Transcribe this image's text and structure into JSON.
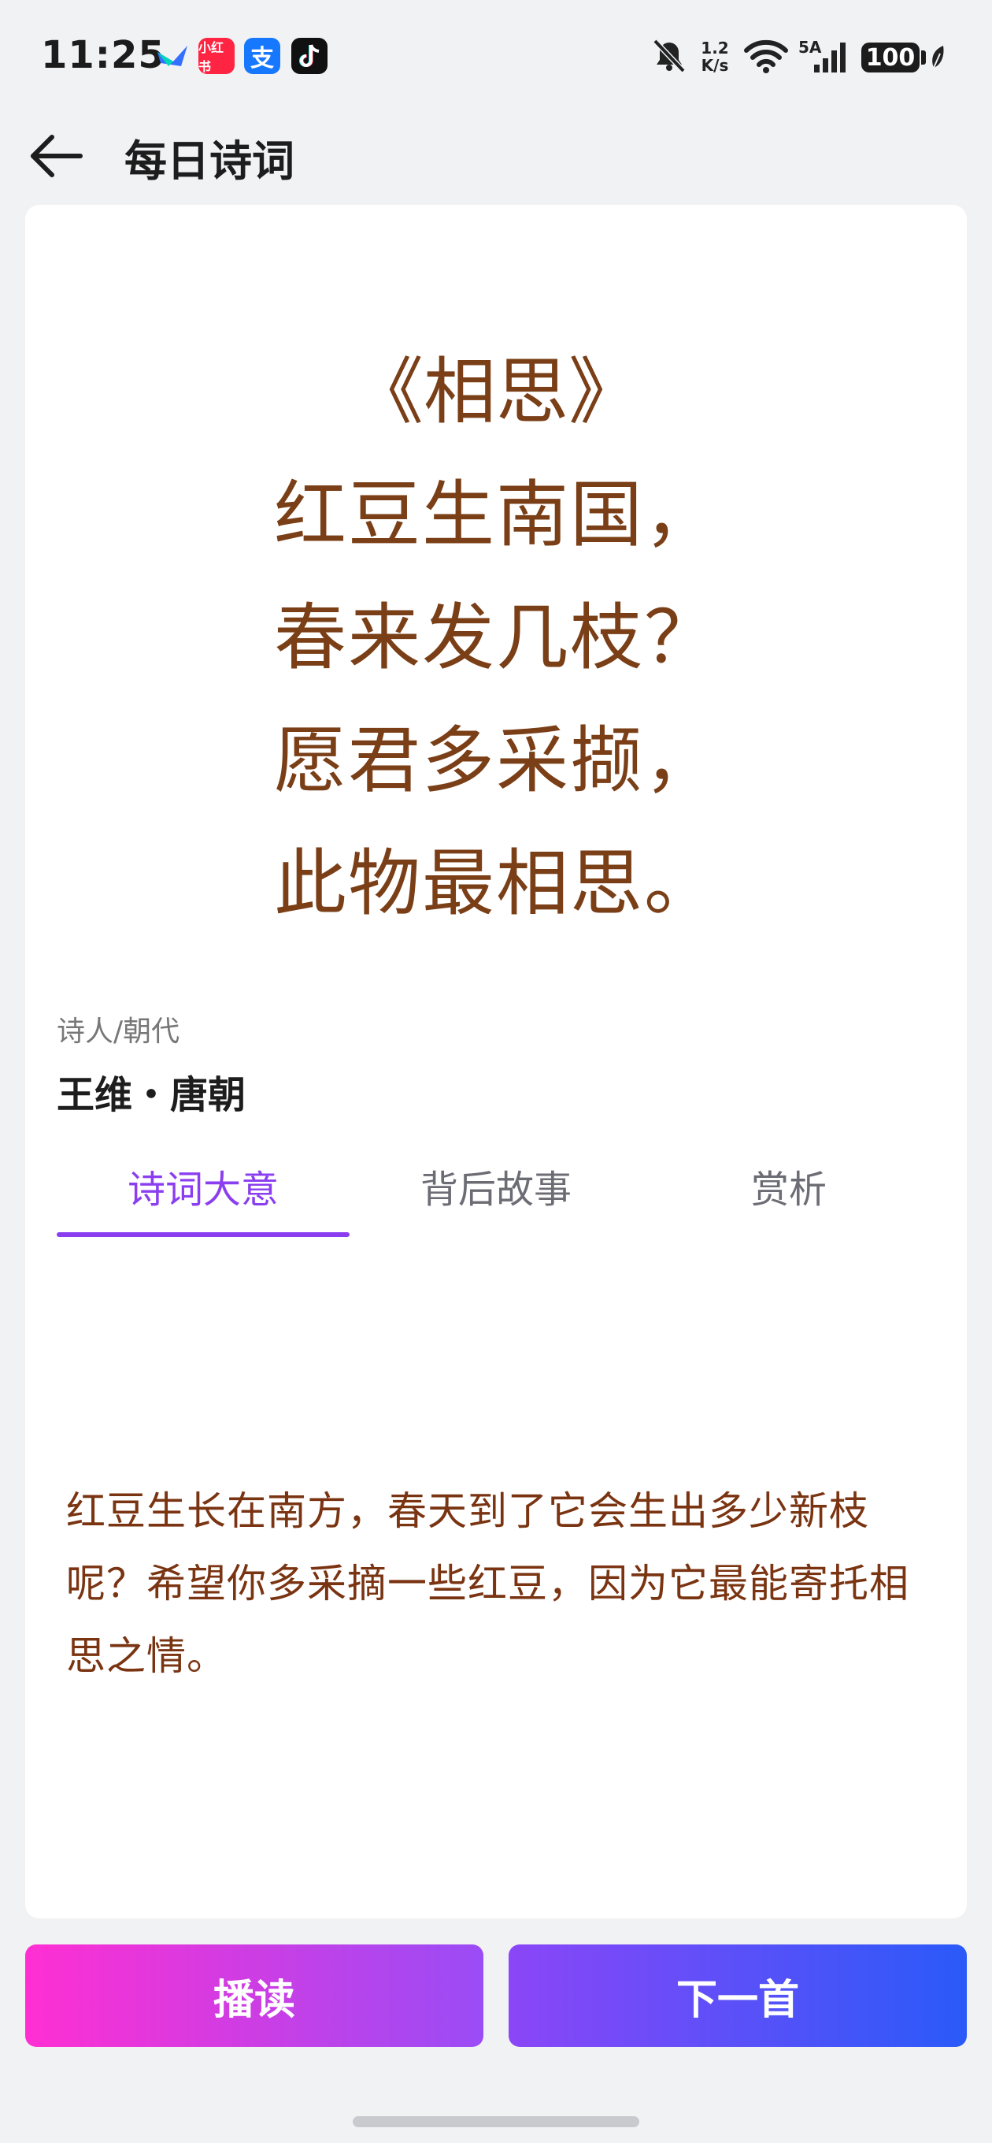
{
  "status_bar": {
    "time": "11:25",
    "apps": [
      {
        "name": "feishu-app-icon",
        "color": "#3370ff"
      },
      {
        "name": "xiaohongshu-app-icon",
        "label": "小红书",
        "color": "#ff2442"
      },
      {
        "name": "alipay-app-icon",
        "label": "支",
        "color": "#1677ff"
      },
      {
        "name": "tiktok-app-icon",
        "color": "#111111"
      }
    ],
    "net_speed_top": "1.2",
    "net_speed_bottom": "K/s",
    "signal_label": "5A",
    "battery": "100"
  },
  "header": {
    "title": "每日诗词"
  },
  "poem": {
    "title": "《相思》",
    "lines": [
      "红豆生南国，",
      "春来发几枝？",
      "愿君多采撷，",
      "此物最相思。"
    ]
  },
  "author": {
    "label": "诗人/朝代",
    "value": "王维・唐朝"
  },
  "tabs": [
    {
      "label": "诗词大意",
      "active": true
    },
    {
      "label": "背后故事",
      "active": false
    },
    {
      "label": "赏析",
      "active": false
    }
  ],
  "content": {
    "meaning": "红豆生长在南方，春天到了它会生出多少新枝呢？希望你多采摘一些红豆，因为它最能寄托相思之情。"
  },
  "actions": {
    "read_label": "播读",
    "next_label": "下一首"
  },
  "colors": {
    "accent": "#8a3ef0",
    "poem_text": "#7a3f17"
  }
}
